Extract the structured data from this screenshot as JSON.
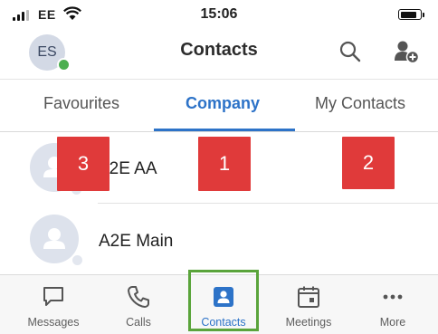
{
  "status_bar": {
    "carrier": "EE",
    "time": "15:06",
    "battery_level": 0.85
  },
  "header": {
    "avatar_initials": "ES",
    "title": "Contacts"
  },
  "tabs": [
    {
      "label": "Favourites",
      "active": false
    },
    {
      "label": "Company",
      "active": true
    },
    {
      "label": "My Contacts",
      "active": false
    }
  ],
  "contacts": [
    {
      "name": "A2E AA"
    },
    {
      "name": "A2E Main"
    }
  ],
  "markers": [
    "3",
    "1",
    "2"
  ],
  "nav": [
    {
      "label": "Messages",
      "icon": "message-icon",
      "active": false
    },
    {
      "label": "Calls",
      "icon": "phone-icon",
      "active": false
    },
    {
      "label": "Contacts",
      "icon": "contact-card-icon",
      "active": true
    },
    {
      "label": "Meetings",
      "icon": "calendar-icon",
      "active": false
    },
    {
      "label": "More",
      "icon": "more-dots-icon",
      "active": false
    }
  ],
  "colors": {
    "accent": "#2d73c8",
    "presence": "#4caf50",
    "marker": "#e03a3a",
    "highlight": "#5aa43b"
  }
}
